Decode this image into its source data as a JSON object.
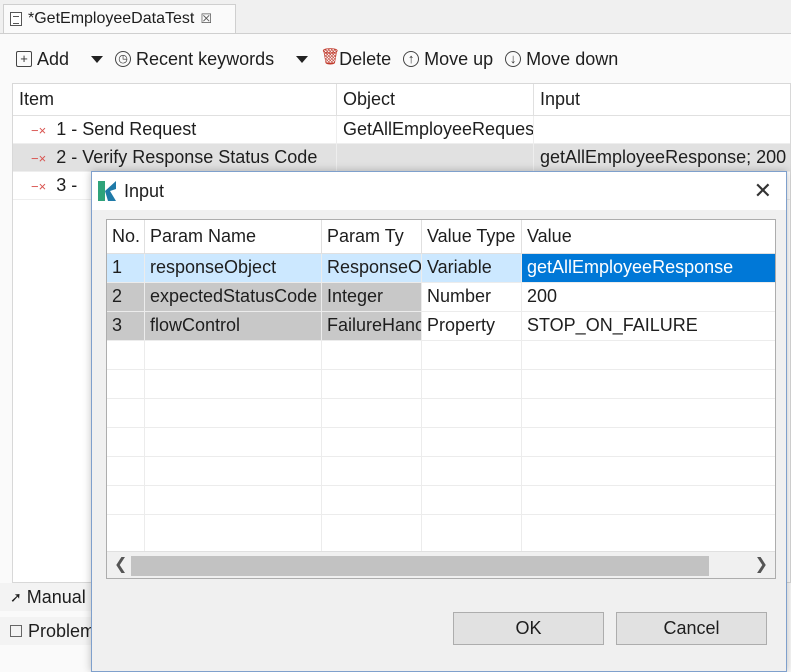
{
  "editor_tab": {
    "title": "*GetEmployeeDataTest"
  },
  "toolbar": {
    "add_label": "Add",
    "recent_label": "Recent keywords",
    "delete_label": "Delete",
    "move_up_label": "Move up",
    "move_down_label": "Move down"
  },
  "grid": {
    "headers": [
      "Item",
      "Object",
      "Input"
    ],
    "rows": [
      {
        "item": "1 - Send Request",
        "object": "GetAllEmployeeRequest",
        "input": ""
      },
      {
        "item": "2 - Verify Response Status Code",
        "object": "",
        "input": "getAllEmployeeResponse; 200"
      },
      {
        "item": "3 -",
        "object": "",
        "input": ""
      }
    ]
  },
  "bottom_tabs": {
    "manual": "Manual",
    "problems": "Problem"
  },
  "dialog": {
    "title": "Input",
    "headers": [
      "No.",
      "Param Name",
      "Param Ty",
      "Value Type",
      "Value"
    ],
    "rows": [
      {
        "no": "1",
        "name": "responseObject",
        "ptype": "ResponseO",
        "vtype": "Variable",
        "value": "getAllEmployeeResponse"
      },
      {
        "no": "2",
        "name": "expectedStatusCode",
        "ptype": "Integer",
        "vtype": "Number",
        "value": "200"
      },
      {
        "no": "3",
        "name": "flowControl",
        "ptype": "FailureHanc",
        "vtype": "Property",
        "value": "STOP_ON_FAILURE"
      }
    ],
    "ok_label": "OK",
    "cancel_label": "Cancel"
  },
  "colors": {
    "selection": "#0078d7",
    "selection_light": "#cce8ff",
    "dialog_border": "#7fa0cc",
    "error_x": "#d9534f"
  }
}
